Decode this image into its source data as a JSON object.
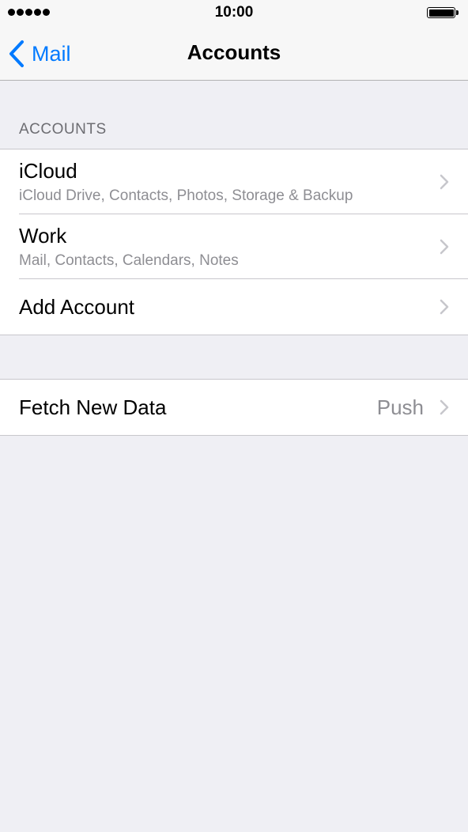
{
  "status_bar": {
    "time": "10:00"
  },
  "nav": {
    "back_label": "Mail",
    "title": "Accounts"
  },
  "accounts_section": {
    "header": "ACCOUNTS",
    "rows": [
      {
        "title": "iCloud",
        "subtitle": "iCloud Drive, Contacts, Photos, Storage & Backup"
      },
      {
        "title": "Work",
        "subtitle": "Mail, Contacts, Calendars, Notes"
      },
      {
        "title": "Add Account"
      }
    ]
  },
  "fetch_section": {
    "title": "Fetch New Data",
    "value": "Push"
  },
  "colors": {
    "accent": "#007aff",
    "background": "#efeff4",
    "secondary_text": "#8e8e93",
    "chevron": "#c7c7cc"
  },
  "icons": {
    "back": "chevron-left-icon",
    "disclosure": "chevron-right-icon",
    "signal": "signal-strength-icon",
    "battery": "battery-icon"
  }
}
